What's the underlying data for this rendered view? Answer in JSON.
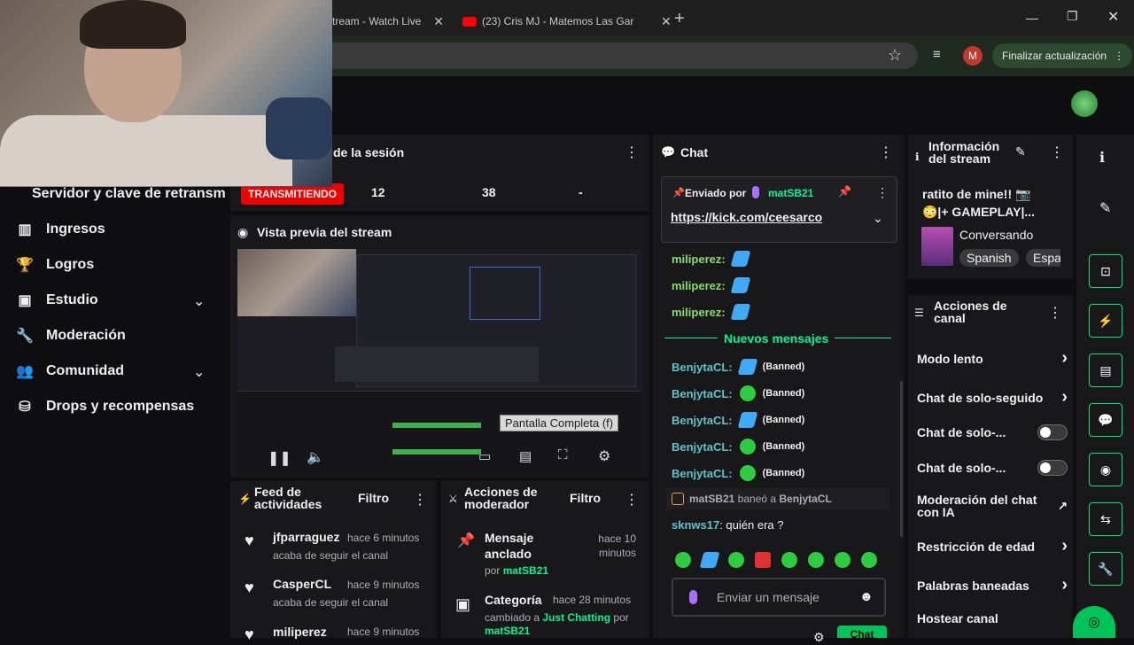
{
  "browser": {
    "tabs": [
      {
        "label": "tream - Watch Live"
      },
      {
        "label": "(23) Cris MJ - Matemos Las Gar"
      }
    ],
    "new_tab": "+",
    "update_button": "Finalizar actualización",
    "profile_initial": "M"
  },
  "stats": {
    "session_title": "de la sesión",
    "live_badge": "TRANSMITIENDO",
    "values": [
      "12",
      "38",
      "-"
    ]
  },
  "sidebar": {
    "header": "Servidor y clave de retransm",
    "items": [
      {
        "label": "Ingresos",
        "icon": "bar-chart-icon"
      },
      {
        "label": "Logros",
        "icon": "trophy-icon"
      },
      {
        "label": "Estudio",
        "icon": "studio-icon"
      },
      {
        "label": "Moderación",
        "icon": "wrench-icon"
      },
      {
        "label": "Comunidad",
        "icon": "people-icon"
      },
      {
        "label": "Drops y recompensas",
        "icon": "gift-icon"
      }
    ]
  },
  "preview": {
    "title": "Vista previa del stream",
    "tooltip": "Pantalla Completa (f)"
  },
  "activity": {
    "title_line1": "Feed de",
    "title_line2": "actividades",
    "filter": "Filtro",
    "items": [
      {
        "user": "jfparraguez",
        "time": "hace 6 minutos",
        "text": "acaba de seguir el canal"
      },
      {
        "user": "CasperCL",
        "time": "hace 9 minutos",
        "text": "acaba de seguir el canal"
      },
      {
        "user": "miliperez",
        "time": "hace 9 minutos",
        "text": ""
      }
    ]
  },
  "modactions": {
    "title_line1": "Acciones de",
    "title_line2": "moderador",
    "filter": "Filtro",
    "items": [
      {
        "title_line1": "Mensaje",
        "title_line2": "anclado",
        "time_line1": "hace 10",
        "time_line2": "minutos",
        "by": "por",
        "user": "matSB21"
      },
      {
        "title_line1": "Categoría",
        "time_line1": "hace 28 minutos",
        "changed": "cambiado a",
        "category": "Just Chatting",
        "by": "por",
        "user": "matSB21"
      }
    ]
  },
  "chat": {
    "title": "Chat",
    "pinned_label": "Enviado por",
    "pinned_user": "matSB21",
    "pinned_link": "https://kick.com/ceesarco",
    "messages_top": [
      {
        "user": "miliperez:"
      },
      {
        "user": "miliperez:"
      },
      {
        "user": "miliperez:"
      }
    ],
    "new_messages": "Nuevos mensajes",
    "banned_messages": [
      {
        "user": "BenjytaCL:",
        "tag": "(Banned)",
        "emote": "blue"
      },
      {
        "user": "BenjytaCL:",
        "tag": "(Banned)",
        "emote": "green"
      },
      {
        "user": "BenjytaCL:",
        "tag": "(Banned)",
        "emote": "blue"
      },
      {
        "user": "BenjytaCL:",
        "tag": "(Banned)",
        "emote": "green"
      },
      {
        "user": "BenjytaCL:",
        "tag": "(Banned)",
        "emote": "green"
      }
    ],
    "ban_notice": {
      "mod": "matSB21",
      "verb": "baneó a",
      "target": "BenjytaCL"
    },
    "last_message": {
      "user": "sknws17",
      "text": ": quién era ?"
    },
    "input_placeholder": "Enviar un mensaje",
    "send_button": "Chat"
  },
  "stream_info": {
    "title_line1": "Información",
    "title_line2": "del stream",
    "stream_title_line1": "ratito de mine!! 📷",
    "stream_title_line2": "😳|+ GAMEPLAY|...",
    "category": "Conversando",
    "tags": [
      "Spanish",
      "Espa"
    ]
  },
  "channel_actions": {
    "title_line1": "Acciones de",
    "title_line2": "canal",
    "items": [
      {
        "label": "Modo lento",
        "control": "chevron"
      },
      {
        "label": "Chat de solo-seguido",
        "control": "chevron"
      },
      {
        "label": "Chat de solo-...",
        "control": "toggle"
      },
      {
        "label": "Chat de solo-...",
        "control": "toggle"
      },
      {
        "label_line1": "Moderación del chat",
        "label_line2": "con IA",
        "control": "external"
      },
      {
        "label": "Restricción de edad",
        "control": "chevron"
      },
      {
        "label": "Palabras baneadas",
        "control": "chevron"
      },
      {
        "label": "Hostear canal",
        "control": "none"
      }
    ]
  },
  "colors": {
    "accent_green": "#00f593",
    "live_red": "#eb0400",
    "chat_user_green": "#8bdb6c",
    "chat_user_cyan": "#5fc3c9",
    "twitch_purple": "#a970ff"
  }
}
